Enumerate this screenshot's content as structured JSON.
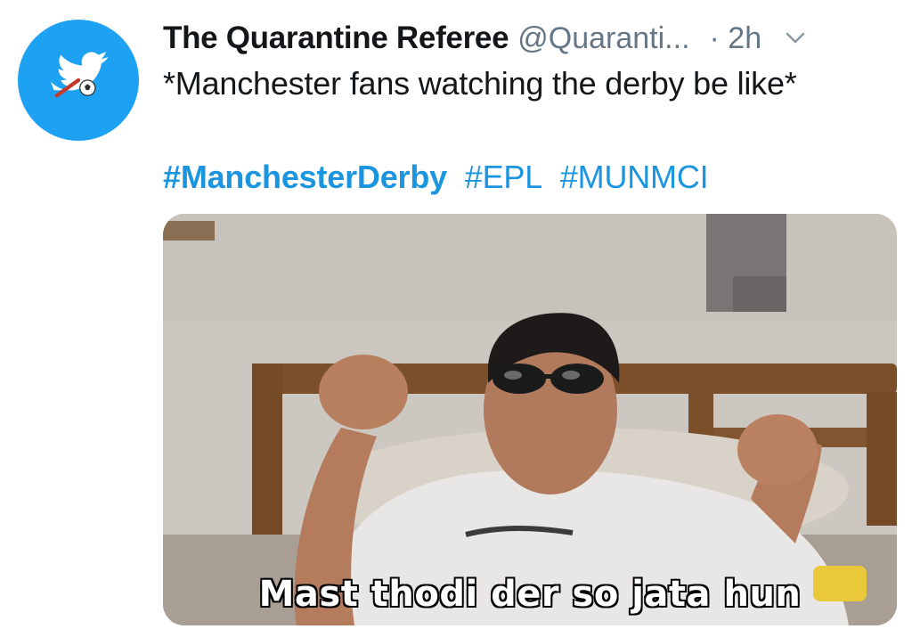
{
  "tweet": {
    "display_name": "The Quarantine Referee",
    "handle": "@Quaranti...",
    "time": "· 2h",
    "text": "*Manchester fans watching the derby be like*",
    "hashtags": [
      "#ManchesterDerby",
      "#EPL",
      "#MUNMCI"
    ],
    "media_caption": "Mast thodi der so jata hun"
  },
  "icons": {
    "avatar": "bird-with-football-icon",
    "menu": "chevron-down-icon"
  },
  "colors": {
    "avatar_bg": "#1da1f2",
    "link": "#1b95e0",
    "secondary_text": "#657786",
    "primary_text": "#14171a"
  }
}
